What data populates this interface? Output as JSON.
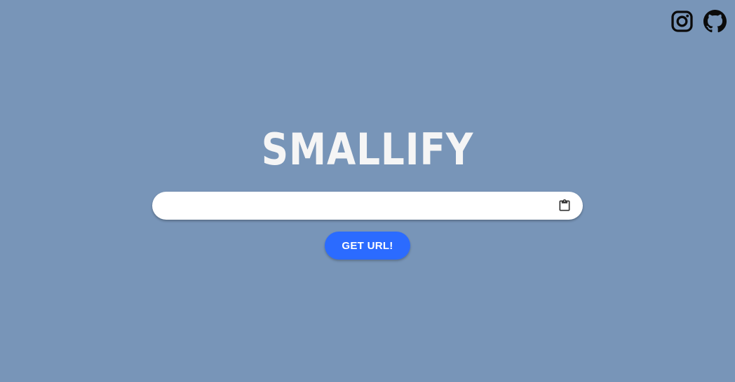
{
  "header": {
    "links": [
      {
        "name": "instagram",
        "icon": "instagram-icon"
      },
      {
        "name": "github",
        "icon": "github-icon"
      }
    ]
  },
  "main": {
    "title": "SMALLIFY",
    "url_input": {
      "value": "",
      "placeholder": ""
    },
    "clipboard_icon": "clipboard-icon",
    "submit_label": "GET URL!"
  },
  "colors": {
    "background": "#7895b8",
    "button": "#2b6bff",
    "title": "#f5f5f5"
  }
}
